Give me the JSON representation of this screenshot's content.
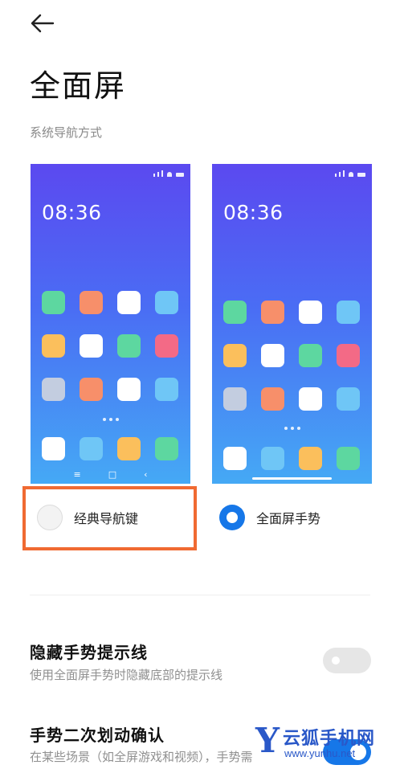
{
  "header": {
    "back_icon": "arrow-left-icon",
    "title": "全面屏"
  },
  "section": {
    "label": "系统导航方式"
  },
  "previews": [
    {
      "time": "08:36",
      "nav": "classic",
      "nav_keys": [
        "≡",
        "□",
        "‹"
      ]
    },
    {
      "time": "08:36",
      "nav": "gesture"
    }
  ],
  "options": [
    {
      "label": "经典导航键",
      "selected": false
    },
    {
      "label": "全面屏手势",
      "selected": true
    }
  ],
  "settings": [
    {
      "title": "隐藏手势提示线",
      "description": "使用全面屏手势时隐藏底部的提示线",
      "enabled": false
    },
    {
      "title": "手势二次划动确认",
      "description": "在某些场景（如全屏游戏和视频），手势需",
      "enabled": true
    }
  ],
  "watermark": {
    "logo_letter": "Y",
    "name": "云狐手机网",
    "url": "www.yunhu.net"
  },
  "colors": {
    "accent": "#1677e8",
    "highlight": "#f06a32",
    "app_green": "#5dd7a0",
    "app_orange": "#f78f6a",
    "app_white": "#ffffff",
    "app_cyan": "#6fc6f6",
    "app_yellow": "#fbbf5c",
    "app_red": "#f36a86",
    "app_gray": "#c3cde0"
  }
}
